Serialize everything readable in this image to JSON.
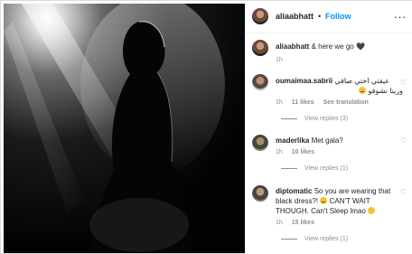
{
  "header": {
    "username": "aliaabhatt",
    "separator": "•",
    "follow_label": "Follow",
    "more_label": "..."
  },
  "caption": {
    "username": "aliaabhatt",
    "text": "& here we go",
    "heart_emoji": "🖤",
    "time": "1h"
  },
  "comments": [
    {
      "username": "oumaimaa.sabrii",
      "text_line1": "عيقتي اختي صافي",
      "text_line2": "ورينا نشوفو",
      "time": "1h",
      "likes": "11 likes",
      "translation_label": "See translation",
      "replies_label": "View replies (3)"
    },
    {
      "username": "maderlika",
      "text": "Met gala?",
      "time": "1h",
      "likes": "10 likes",
      "replies_label": "View replies (1)"
    },
    {
      "username": "diptomatic",
      "text_line1": "So you are wearing that",
      "text_line2": "black dress?!",
      "text_line2b": "CAN'T WAIT",
      "text_line3": "THOUGH. Can't Sleep lmao",
      "time": "1h",
      "likes": "15 likes",
      "replies_label": "View replies (1)"
    }
  ],
  "icons": {
    "heart": "♡",
    "verified": "✔"
  },
  "colors": {
    "accent": "#0095f6",
    "muted": "#8e8e8e",
    "text": "#262626"
  }
}
